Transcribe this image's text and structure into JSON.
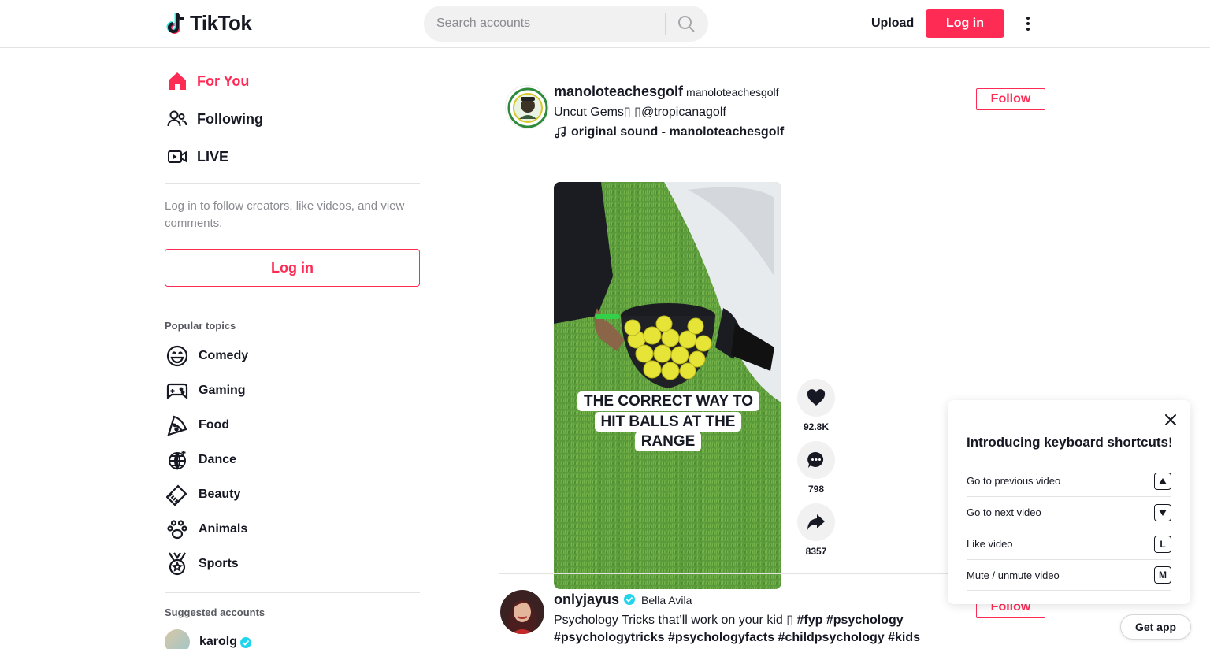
{
  "header": {
    "logo_text": "TikTok",
    "search_placeholder": "Search accounts",
    "upload_label": "Upload",
    "login_label": "Log in"
  },
  "sidebar": {
    "nav": [
      {
        "label": "For You",
        "icon": "home-icon",
        "active": true
      },
      {
        "label": "Following",
        "icon": "people-icon",
        "active": false
      },
      {
        "label": "LIVE",
        "icon": "live-icon",
        "active": false
      }
    ],
    "login_hint": "Log in to follow creators, like videos, and view comments.",
    "login_button": "Log in",
    "popular_topics_title": "Popular topics",
    "topics": [
      {
        "label": "Comedy",
        "icon": "smile-icon"
      },
      {
        "label": "Gaming",
        "icon": "gamepad-icon"
      },
      {
        "label": "Food",
        "icon": "pizza-icon"
      },
      {
        "label": "Dance",
        "icon": "disco-ball-icon"
      },
      {
        "label": "Beauty",
        "icon": "comb-icon"
      },
      {
        "label": "Animals",
        "icon": "paw-icon"
      },
      {
        "label": "Sports",
        "icon": "medal-icon"
      }
    ],
    "suggested_title": "Suggested accounts",
    "suggested": [
      {
        "name": "karolg",
        "verified": true
      }
    ]
  },
  "feed": {
    "posts": [
      {
        "author_id": "manoloteachesgolf",
        "author_nick": "manoloteachesgolf",
        "caption": "Uncut Gems▯ ▯@tropicanagolf",
        "music": "original sound - manoloteachesgolf",
        "follow_label": "Follow",
        "video_overlay": "THE CORRECT WAY TO HIT BALLS AT THE RANGE",
        "likes": "92.8K",
        "comments": "798",
        "shares": "8357"
      },
      {
        "author_id": "onlyjayus",
        "author_nick": "Bella Avila",
        "verified": true,
        "caption_text": "Psychology Tricks that’ll work on your kid ▯ ",
        "caption_tags_line1": "#fyp #psychology",
        "caption_tags_line2": "#psychologytricks #psychologyfacts #childpsychology #kids #parents",
        "follow_label": "Follow"
      }
    ]
  },
  "shortcuts_popup": {
    "title": "Introducing keyboard shortcuts!",
    "rows": [
      {
        "label": "Go to previous video",
        "key": "▲"
      },
      {
        "label": "Go to next video",
        "key": "▼"
      },
      {
        "label": "Like video",
        "key": "L"
      },
      {
        "label": "Mute / unmute video",
        "key": "M"
      }
    ]
  },
  "get_app_label": "Get app",
  "colors": {
    "brand": "#fe2c55",
    "text": "#161823",
    "muted": "#8a8b91",
    "verified": "#20d5ec"
  }
}
